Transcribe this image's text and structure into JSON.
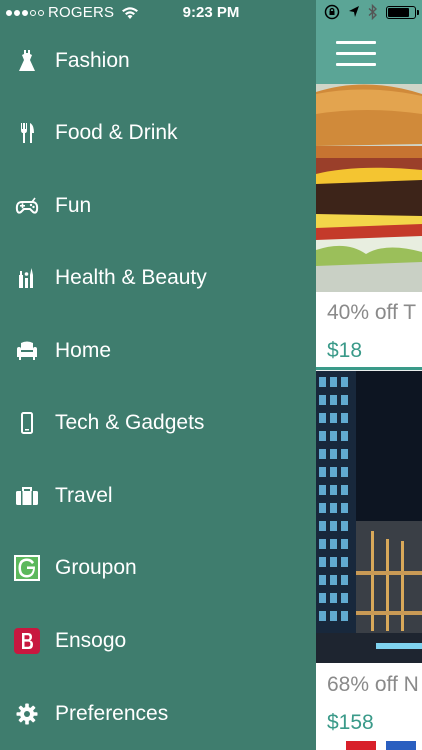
{
  "status_bar": {
    "carrier": "ROGERS",
    "time": "9:23 PM",
    "signal_bars_filled": 3,
    "signal_bars_total": 5,
    "battery_level": 0.85
  },
  "menu": {
    "items": [
      {
        "label": "Fashion",
        "icon": "dress-icon"
      },
      {
        "label": "Food & Drink",
        "icon": "fork-knife-icon"
      },
      {
        "label": "Fun",
        "icon": "gamepad-icon"
      },
      {
        "label": "Health & Beauty",
        "icon": "beauty-tools-icon"
      },
      {
        "label": "Home",
        "icon": "armchair-icon"
      },
      {
        "label": "Tech & Gadgets",
        "icon": "phone-icon"
      },
      {
        "label": "Travel",
        "icon": "suitcase-icon"
      },
      {
        "label": "Groupon",
        "icon": "groupon-logo-icon"
      },
      {
        "label": "Ensogo",
        "icon": "ensogo-logo-icon"
      },
      {
        "label": "Preferences",
        "icon": "gear-icon"
      }
    ]
  },
  "deals": [
    {
      "title": "40% off T",
      "price": "$18",
      "image": "burger-image"
    },
    {
      "title": "68% off N",
      "price": "$158",
      "image": "hotel-building-image"
    }
  ],
  "colors": {
    "drawer_bg": "#3f7d6e",
    "header_bg": "#5ba596",
    "price_accent": "#3a9a89",
    "groupon_green": "#5cb85c",
    "ensogo_red": "#c8173f"
  }
}
